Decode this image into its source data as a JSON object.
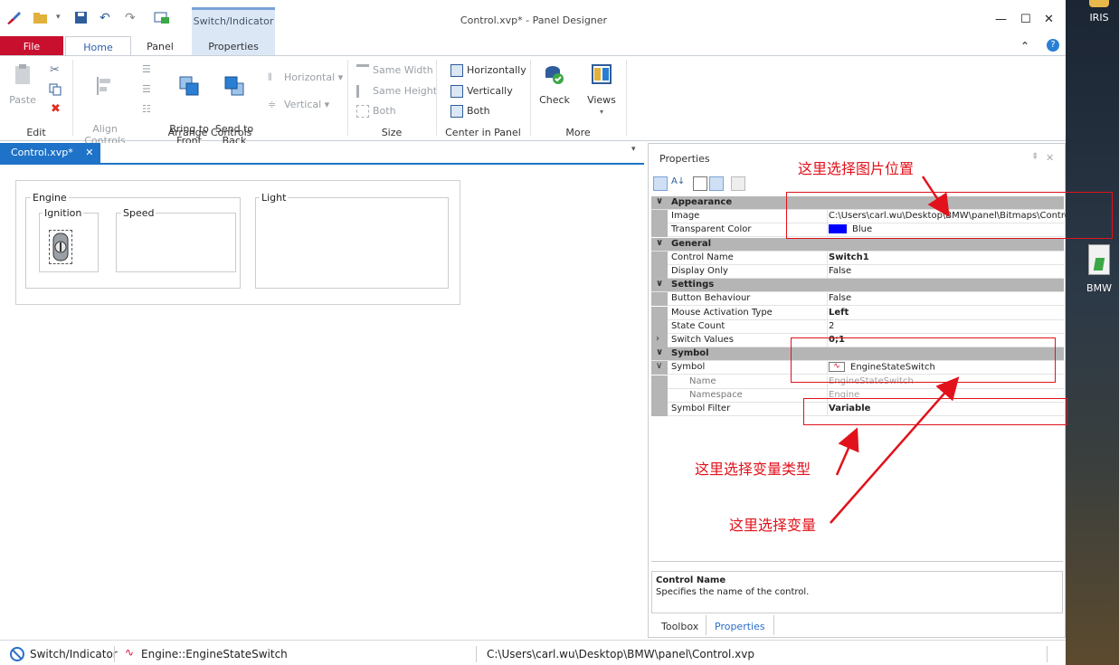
{
  "titlebar": {
    "context_tab": "Switch/Indicator",
    "window_title": "Control.xvp* - Panel Designer"
  },
  "ribbon": {
    "tabs": [
      "File",
      "Home",
      "Panel",
      "Properties"
    ],
    "edit": {
      "label": "Edit",
      "paste": "Paste"
    },
    "arrange": {
      "label": "Arrange Controls",
      "align": "Align\nControls",
      "bring_front": "Bring to\nFront",
      "send_back": "Send to\nBack",
      "horizontal": "Horizontal",
      "vertical": "Vertical"
    },
    "size": {
      "label": "Size",
      "same_width": "Same Width",
      "same_height": "Same Height",
      "both": "Both"
    },
    "center": {
      "label": "Center in Panel",
      "horizontally": "Horizontally",
      "vertically": "Vertically",
      "both": "Both"
    },
    "more": {
      "label": "More",
      "check": "Check",
      "views": "Views"
    }
  },
  "document": {
    "tab_label": "Control.xvp*",
    "groups": {
      "engine": "Engine",
      "ignition": "Ignition",
      "speed": "Speed",
      "light": "Light"
    }
  },
  "properties": {
    "title": "Properties",
    "rows": [
      {
        "type": "category",
        "name": "Appearance"
      },
      {
        "type": "prop",
        "name": "Image",
        "value": "C:\\Users\\carl.wu\\Desktop\\BMW\\panel\\Bitmaps\\ControlIgnition.bmp"
      },
      {
        "type": "prop",
        "name": "Transparent Color",
        "value": "Blue",
        "swatch": "#0000ff"
      },
      {
        "type": "category",
        "name": "General"
      },
      {
        "type": "prop",
        "name": "Control Name",
        "value": "Switch1",
        "bold": true
      },
      {
        "type": "prop",
        "name": "Display Only",
        "value": "False"
      },
      {
        "type": "category",
        "name": "Settings"
      },
      {
        "type": "prop",
        "name": "Button Behaviour",
        "value": "False"
      },
      {
        "type": "prop",
        "name": "Mouse Activation Type",
        "value": "Left",
        "bold": true
      },
      {
        "type": "prop",
        "name": "State Count",
        "value": "2"
      },
      {
        "type": "prop",
        "name": "Switch Values",
        "value": "0;1",
        "bold": true,
        "expander": ">"
      },
      {
        "type": "category",
        "name": "Symbol"
      },
      {
        "type": "prop",
        "name": "Symbol",
        "value": "EngineStateSwitch",
        "expander": "v"
      },
      {
        "type": "sub",
        "name": "Name",
        "value": "EngineStateSwitch"
      },
      {
        "type": "sub",
        "name": "Namespace",
        "value": "Engine"
      },
      {
        "type": "prop",
        "name": "Symbol Filter",
        "value": "Variable",
        "bold": true
      }
    ],
    "description_title": "Control Name",
    "description_text": "Specifies the name of the control.",
    "bottom_tabs": [
      "Toolbox",
      "Properties"
    ]
  },
  "statusbar": {
    "item1": "Switch/Indicator",
    "item2": "Engine::EngineStateSwitch",
    "path": "C:\\Users\\carl.wu\\Desktop\\BMW\\panel\\Control.xvp"
  },
  "desktop": {
    "icon1": "IRIS",
    "icon2": "BMW"
  },
  "annotations": {
    "image_location": "这里选择图片位置",
    "variable_type": "这里选择变量类型",
    "variable": "这里选择变量"
  },
  "colors": {
    "accent": "#1e73c8",
    "file_tab": "#c8102e",
    "annotation": "#e1121b"
  }
}
